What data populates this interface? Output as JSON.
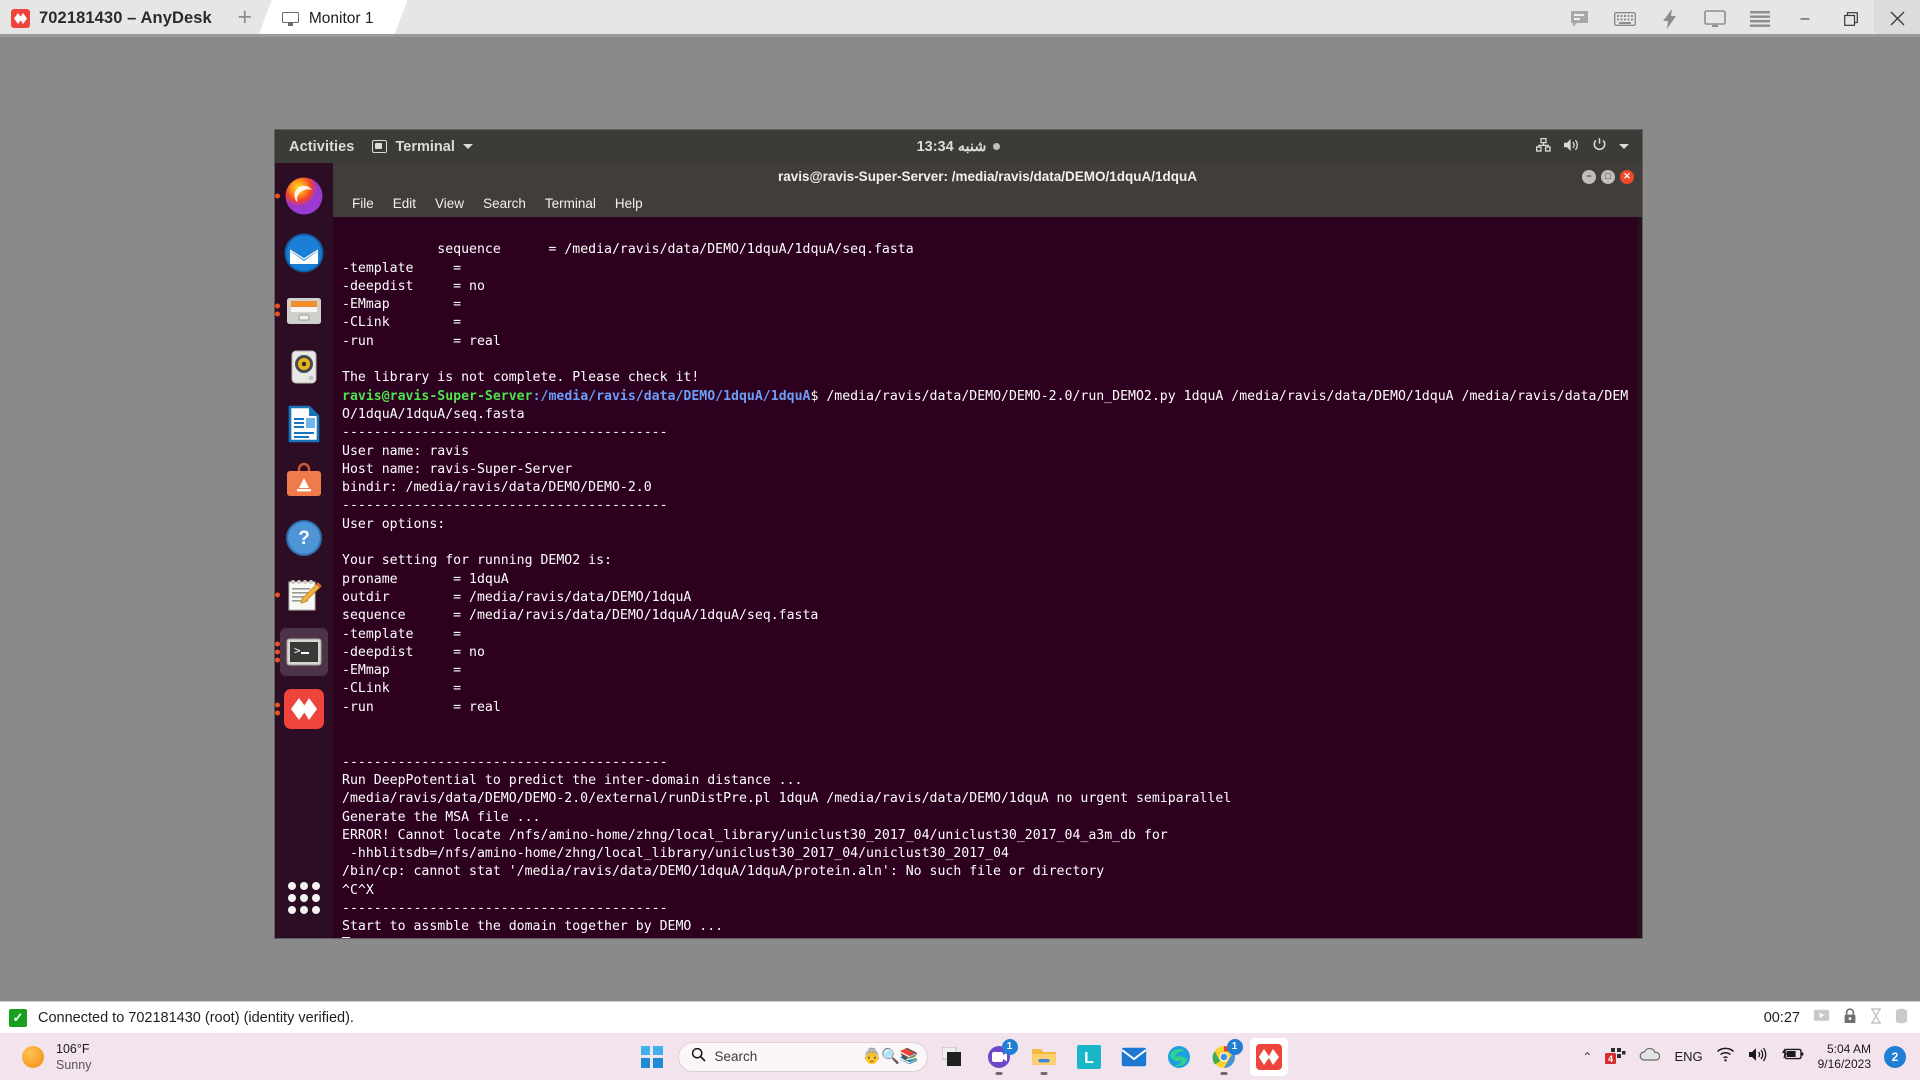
{
  "anydesk": {
    "title": "702181430 – AnyDesk",
    "logo_icon": "anydesk-logo-icon",
    "new_tab_label": "+",
    "tabs": [
      {
        "label": "Monitor 1",
        "icon": "monitor-icon",
        "active": true
      }
    ],
    "toolbar_icons": [
      "chat-icon",
      "keyboard-icon",
      "actions-lightning-icon",
      "display-icon",
      "menu-hamburger-icon"
    ],
    "window_buttons": {
      "minimize": "–",
      "maximize": "❐",
      "close": "✕"
    },
    "statusbar": {
      "connection_text": "Connected to 702181430 (root) (identity verified).",
      "verified_icon": "green-check-icon",
      "session_timer": "00:27",
      "right_icons": [
        "screen-record-icon",
        "lock-icon",
        "hourglass-icon",
        "storage-icon"
      ]
    }
  },
  "ubuntu": {
    "topbar": {
      "activities": "Activities",
      "app_menu": "Terminal",
      "app_menu_icon": "terminal-app-icon",
      "clock": "شنبه 13:34",
      "clock_dot_icon": "notification-dot-icon",
      "status_icons": [
        "network-icon",
        "volume-icon",
        "power-icon",
        "chevron-down-icon"
      ]
    },
    "dock": {
      "items": [
        {
          "name": "firefox",
          "label": "Firefox",
          "running": true,
          "active": false
        },
        {
          "name": "thunderbird",
          "label": "Thunderbird",
          "running": false,
          "active": false
        },
        {
          "name": "files",
          "label": "Files",
          "running": true,
          "active": false
        },
        {
          "name": "rhythmbox",
          "label": "Rhythmbox",
          "running": false,
          "active": false
        },
        {
          "name": "libreoffice-writer",
          "label": "LibreOffice Writer",
          "running": false,
          "active": false
        },
        {
          "name": "ubuntu-software",
          "label": "Ubuntu Software",
          "running": false,
          "active": false
        },
        {
          "name": "help",
          "label": "Help",
          "running": false,
          "active": false
        },
        {
          "name": "text-editor",
          "label": "Text Editor",
          "running": true,
          "active": false
        },
        {
          "name": "terminal",
          "label": "Terminal",
          "running": true,
          "active": true
        },
        {
          "name": "anydesk",
          "label": "AnyDesk",
          "running": true,
          "active": false
        }
      ],
      "app_grid_label": "Show Applications"
    },
    "terminal": {
      "window_title": "ravis@ravis-Super-Server: /media/ravis/data/DEMO/1dquA/1dquA",
      "menu": [
        "File",
        "Edit",
        "View",
        "Search",
        "Terminal",
        "Help"
      ],
      "window_controls": {
        "minimize": "_",
        "maximize": "□",
        "close": "✕"
      },
      "prompt_user": "ravis@ravis-Super-Server",
      "prompt_path": ":/media/ravis/data/DEMO/1dquA/1dquA",
      "prompt_sigil": "$ ",
      "command": "/media/ravis/data/DEMO/DEMO-2.0/run_DEMO2.py 1dquA /media/ravis/data/DEMO/1dquA /media/ravis/data/DEMO/1dquA/1dquA/seq.fasta",
      "lines_before": [
        "sequence      = /media/ravis/data/DEMO/1dquA/1dquA/seq.fasta",
        "-template     =",
        "-deepdist     = no",
        "-EMmap        =",
        "-CLink        =",
        "-run          = real",
        "",
        "The library is not complete. Please check it!"
      ],
      "lines_after": [
        "-----------------------------------------",
        "User name: ravis",
        "Host name: ravis-Super-Server",
        "bindir: /media/ravis/data/DEMO/DEMO-2.0",
        "-----------------------------------------",
        "User options:",
        "",
        "Your setting for running DEMO2 is:",
        "proname       = 1dquA",
        "outdir        = /media/ravis/data/DEMO/1dquA",
        "sequence      = /media/ravis/data/DEMO/1dquA/1dquA/seq.fasta",
        "-template     =",
        "-deepdist     = no",
        "-EMmap        =",
        "-CLink        =",
        "-run          = real",
        "",
        "",
        "-----------------------------------------",
        "Run DeepPotential to predict the inter-domain distance ...",
        "/media/ravis/data/DEMO/DEMO-2.0/external/runDistPre.pl 1dquA /media/ravis/data/DEMO/1dquA no urgent semiparallel",
        "Generate the MSA file ...",
        "ERROR! Cannot locate /nfs/amino-home/zhng/local_library/uniclust30_2017_04/uniclust30_2017_04_a3m_db for",
        " -hhblitsdb=/nfs/amino-home/zhng/local_library/uniclust30_2017_04/uniclust30_2017_04",
        "/bin/cp: cannot stat '/media/ravis/data/DEMO/1dquA/1dquA/protein.aln': No such file or directory",
        "^C^X",
        "-----------------------------------------",
        "Start to assmble the domain together by DEMO ..."
      ]
    }
  },
  "windows_taskbar": {
    "weather": {
      "temperature": "106°F",
      "condition": "Sunny",
      "icon": "sun-icon"
    },
    "start_label": "Start",
    "search": {
      "placeholder": "Search",
      "icon": "search-icon"
    },
    "apps": [
      {
        "name": "task-view",
        "label": "Task View",
        "running": false,
        "active": false
      },
      {
        "name": "microsoft-teams",
        "label": "Microsoft Teams",
        "running": true,
        "active": false,
        "badge": "1"
      },
      {
        "name": "file-explorer",
        "label": "File Explorer",
        "running": true,
        "active": false
      },
      {
        "name": "libreoffice",
        "label": "LibreOffice",
        "running": false,
        "active": false
      },
      {
        "name": "mail",
        "label": "Mail",
        "running": false,
        "active": false
      },
      {
        "name": "microsoft-edge",
        "label": "Microsoft Edge",
        "running": false,
        "active": false
      },
      {
        "name": "google-chrome",
        "label": "Google Chrome",
        "running": true,
        "active": false,
        "badge": "1"
      },
      {
        "name": "anydesk",
        "label": "AnyDesk",
        "running": true,
        "active": true
      }
    ],
    "tray": {
      "chevron": "⌃",
      "icons": [
        "apps-tray-icon",
        "onedrive-icon",
        "wifi-icon",
        "volume-icon",
        "battery-charging-icon"
      ],
      "apps_badge": "4",
      "language": "ENG",
      "time": "5:04 AM",
      "date": "9/16/2023",
      "notification_count": "2"
    }
  }
}
